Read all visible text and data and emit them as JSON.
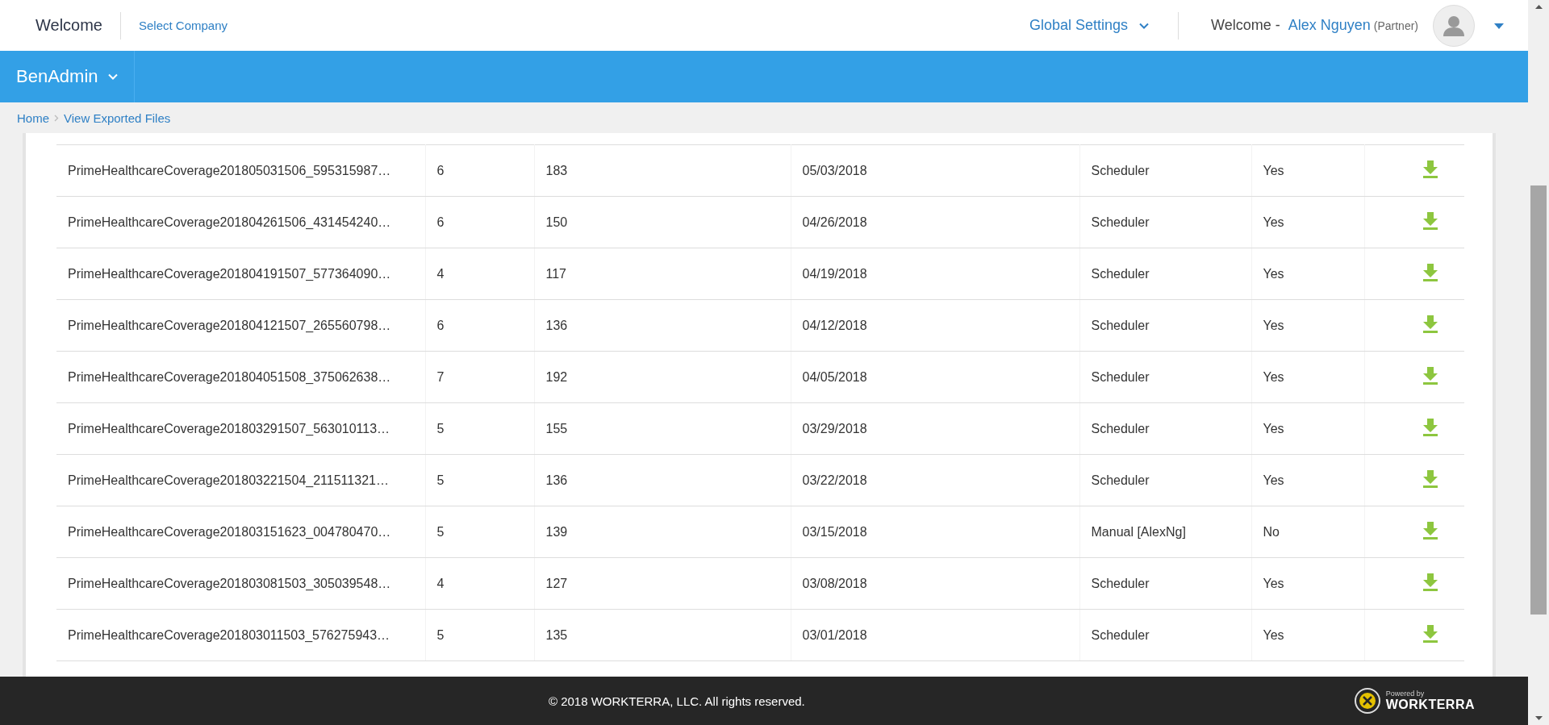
{
  "header": {
    "title": "Welcome",
    "company_link": "Select Company",
    "global_settings": "Global Settings",
    "welcome_label": "Welcome -",
    "user_name": "Alex Nguyen",
    "user_role": "(Partner)"
  },
  "nav": {
    "module": "BenAdmin"
  },
  "breadcrumb": [
    {
      "label": "Home"
    },
    {
      "label": "View Exported Files"
    }
  ],
  "table": {
    "rows": [
      {
        "cells": [
          "PrimeHealthcareCoverage201805031506_595315987…",
          "6",
          "183",
          "05/03/2018",
          "Scheduler",
          "Yes"
        ]
      },
      {
        "cells": [
          "PrimeHealthcareCoverage201804261506_431454240…",
          "6",
          "150",
          "04/26/2018",
          "Scheduler",
          "Yes"
        ]
      },
      {
        "cells": [
          "PrimeHealthcareCoverage201804191507_577364090…",
          "4",
          "117",
          "04/19/2018",
          "Scheduler",
          "Yes"
        ]
      },
      {
        "cells": [
          "PrimeHealthcareCoverage201804121507_265560798…",
          "6",
          "136",
          "04/12/2018",
          "Scheduler",
          "Yes"
        ]
      },
      {
        "cells": [
          "PrimeHealthcareCoverage201804051508_375062638…",
          "7",
          "192",
          "04/05/2018",
          "Scheduler",
          "Yes"
        ]
      },
      {
        "cells": [
          "PrimeHealthcareCoverage201803291507_563010113…",
          "5",
          "155",
          "03/29/2018",
          "Scheduler",
          "Yes"
        ]
      },
      {
        "cells": [
          "PrimeHealthcareCoverage201803221504_211511321…",
          "5",
          "136",
          "03/22/2018",
          "Scheduler",
          "Yes"
        ]
      },
      {
        "cells": [
          "PrimeHealthcareCoverage201803151623_004780470…",
          "5",
          "139",
          "03/15/2018",
          "Manual [AlexNg]",
          "No"
        ]
      },
      {
        "cells": [
          "PrimeHealthcareCoverage201803081503_305039548…",
          "4",
          "127",
          "03/08/2018",
          "Scheduler",
          "Yes"
        ]
      },
      {
        "cells": [
          "PrimeHealthcareCoverage201803011503_576275943…",
          "5",
          "135",
          "03/01/2018",
          "Scheduler",
          "Yes"
        ]
      }
    ]
  },
  "footer": {
    "copyright": "© 2018 WORKTERRA, LLC. All rights reserved.",
    "powered_by": "Powered by",
    "brand": "WORKTERRA"
  }
}
